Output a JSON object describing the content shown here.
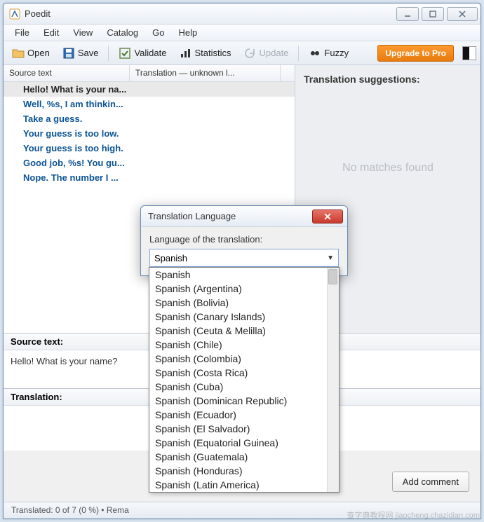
{
  "window": {
    "title": "Poedit"
  },
  "menu": {
    "file": "File",
    "edit": "Edit",
    "view": "View",
    "catalog": "Catalog",
    "go": "Go",
    "help": "Help"
  },
  "toolbar": {
    "open": "Open",
    "save": "Save",
    "validate": "Validate",
    "statistics": "Statistics",
    "update": "Update",
    "fuzzy": "Fuzzy",
    "upgrade": "Upgrade to Pro"
  },
  "columns": {
    "source": "Source text",
    "translation": "Translation — unknown l..."
  },
  "rows": [
    "Hello! What is your na...",
    "Well, %s, I am thinkin...",
    "Take a guess.",
    "Your guess is too low.",
    "Your guess is too high.",
    "Good job, %s! You gu...",
    "Nope. The number I ..."
  ],
  "right": {
    "title": "Translation suggestions:",
    "empty": "No matches found"
  },
  "source": {
    "label": "Source text:",
    "value": "Hello! What is your name?"
  },
  "translation": {
    "label": "Translation:"
  },
  "status": "Translated: 0 of 7 (0 %)  •  Rema",
  "addComment": "Add comment",
  "dialog": {
    "title": "Translation Language",
    "label": "Language of the translation:",
    "value": "Spanish",
    "options": [
      "Spanish",
      "Spanish (Argentina)",
      "Spanish (Bolivia)",
      "Spanish (Canary Islands)",
      "Spanish (Ceuta & Melilla)",
      "Spanish (Chile)",
      "Spanish (Colombia)",
      "Spanish (Costa Rica)",
      "Spanish (Cuba)",
      "Spanish (Dominican Republic)",
      "Spanish (Ecuador)",
      "Spanish (El Salvador)",
      "Spanish (Equatorial Guinea)",
      "Spanish (Guatemala)",
      "Spanish (Honduras)",
      "Spanish (Latin America)"
    ]
  },
  "watermark": "查字典教程网 jiaocheng.chazidian.com"
}
